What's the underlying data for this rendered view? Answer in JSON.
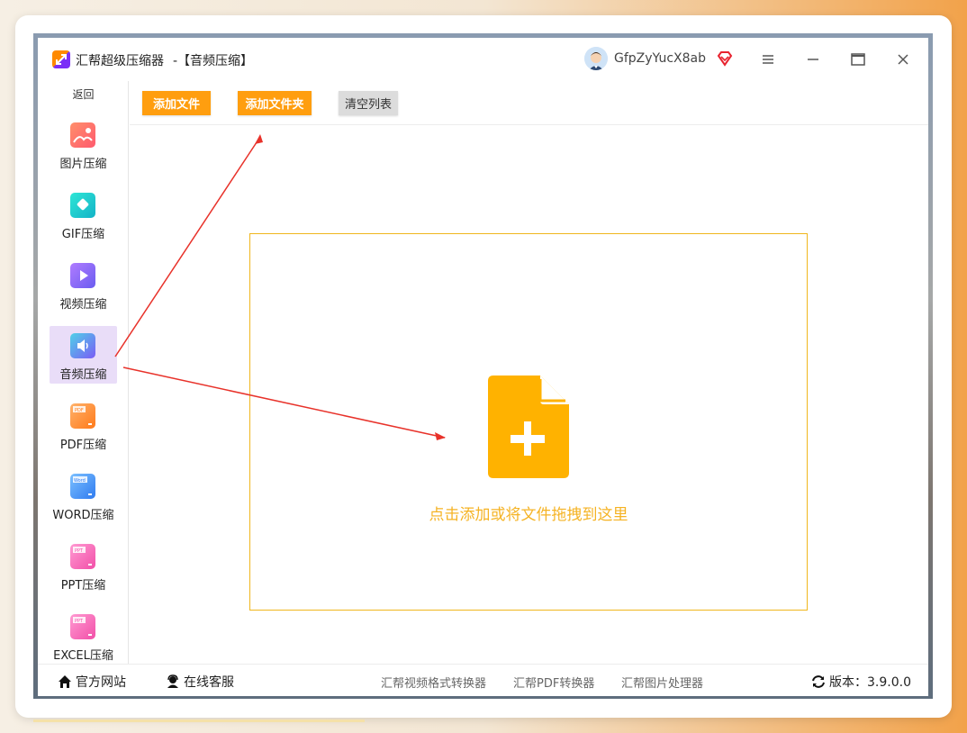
{
  "window": {
    "app_name": "汇帮超级压缩器",
    "page_label": "-【音频压缩】",
    "username": "GfpZyYucX8ab"
  },
  "sidebar": {
    "back_label": "返回",
    "items": [
      {
        "label": "图片压缩",
        "color": "#ff6f61"
      },
      {
        "label": "GIF压缩",
        "color": "#1ec8c8"
      },
      {
        "label": "视频压缩",
        "color": "#8b6cf2"
      },
      {
        "label": "音频压缩",
        "color": "#5a8ef5",
        "active": true
      },
      {
        "label": "PDF压缩",
        "color": "#ff8a2a"
      },
      {
        "label": "WORD压缩",
        "color": "#3d8df5"
      },
      {
        "label": "PPT压缩",
        "color": "#f55fb0"
      },
      {
        "label": "EXCEL压缩",
        "color": "#f55fb0"
      }
    ]
  },
  "toolbar": {
    "add_file": "添加文件",
    "add_folder": "添加文件夹",
    "clear_list": "清空列表"
  },
  "dropzone": {
    "text": "点击添加或将文件拖拽到这里",
    "accent_color": "#ffb200"
  },
  "footer": {
    "website": "官方网站",
    "support": "在线客服",
    "link1": "汇帮视频格式转换器",
    "link2": "汇帮PDF转换器",
    "link3": "汇帮图片处理器",
    "version": "版本：3.9.0.0"
  }
}
